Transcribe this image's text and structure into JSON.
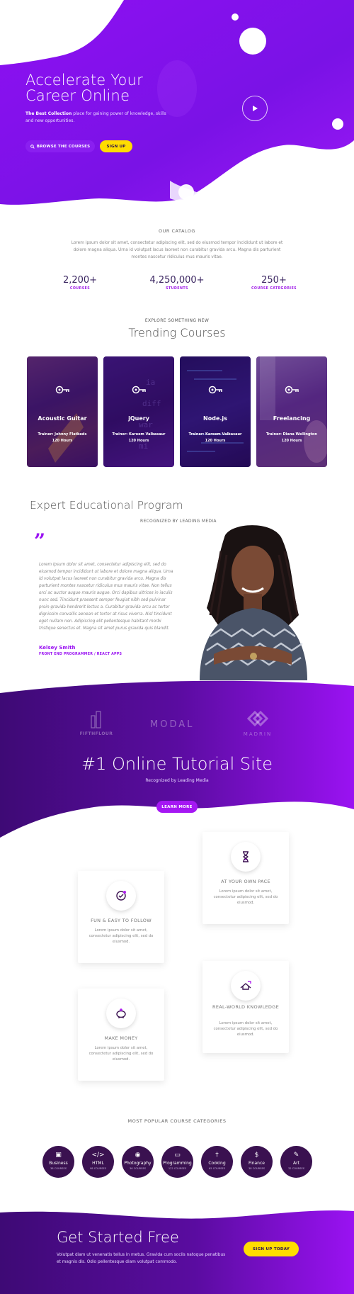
{
  "colors": {
    "brand_purple": "#8e10f2",
    "deep_purple": "#4a0f8a",
    "accent_yellow": "#ffdd00",
    "category_circle": "#3a1150"
  },
  "hero": {
    "title_line1": "Accelerate Your",
    "title_line2": "Career Online",
    "subtitle_bold": "The Best Collection",
    "subtitle_rest": " place for gaining power of knowledge, skills and new opportunities.",
    "browse_label": "BROWSE THE COURSES",
    "signup_label": "SIGN UP",
    "play_icon": "play-icon"
  },
  "catalog": {
    "label": "OUR CATALOG",
    "text": "Lorem ipsum dolor sit amet, consectetur adipiscing elit, sed do eiusmod tempor incididunt ut labore et dolore magna aliqua. Urna id volutpat lacus laoreet non curabitur gravida arcu. Magna dis parturient montes nascetur ridiculus mus mauris vitae.",
    "stats": [
      {
        "value": "2,200+",
        "label": "COURSES"
      },
      {
        "value": "4,250,000+",
        "label": "STUDENTS"
      },
      {
        "value": "250+",
        "label": "COURSE CATEGORIES"
      }
    ]
  },
  "trending": {
    "label": "EXPLORE SOMETHING NEW",
    "title": "Trending Courses",
    "courses": [
      {
        "name": "Acoustic Guitar",
        "trainer": "Trainer: Johnny Flatbeds",
        "hours": "120 Hours"
      },
      {
        "name": "jQuery",
        "trainer": "Trainer: Kareem Valbasaur",
        "hours": "120 Hours"
      },
      {
        "name": "Node.js",
        "trainer": "Trainer: Kareem Valbasaur",
        "hours": "120 Hours"
      },
      {
        "name": "Freelancing",
        "trainer": "Trainer: Diana Wellington",
        "hours": "120 Hours"
      }
    ]
  },
  "expert": {
    "title": "Expert Educational Program",
    "recognized": "RECOGNIZED BY LEADING MEDIA",
    "quote_mark": "”",
    "text": "Lorem ipsum dolor sit amet, consectetur adipiscing elit, sed do eiusmod tempor incididunt ut labore et dolore magna aliqua. Urna id volutpat lacus laoreet non curabitur gravida arcu. Magna dis parturient montes nascetur ridiculus mus mauris vitae. Non tellus orci ac auctor augue mauris augue. Orci dapibus ultrices in iaculis nunc sed. Tincidunt praesent semper feugiat nibh sed pulvinar proin gravida hendrerit lectus a. Curabitur gravida arcu ac tortor dignissim convallis aenean et tortor at risus viverra. Nisl tincidunt eget nullam non. Adipiscing elit pellentesque habitant morbi tristique senectus et. Magna sit amet purus gravida quis blandit.",
    "name": "Kelsey Smith",
    "role": "FRONT END PROGRAMMER / REACT APPS"
  },
  "band": {
    "logos": [
      "FIFTHFLOUR",
      "MODAL",
      "MADRIN"
    ],
    "title": "#1 Online Tutorial Site",
    "subtitle": "Recognized by Leading Media",
    "learn_more": "LEARN MORE"
  },
  "features": [
    {
      "title": "AT YOUR OWN PACE",
      "text": "Lorem ipsum dolor sit amet, consectetur adipiscing elit, sed do eiusmod.",
      "icon": "hourglass-icon"
    },
    {
      "title": "FUN & EASY TO FOLLOW",
      "text": "Lorem ipsum dolor sit amet, consectetur adipiscing elit, sed do eiusmod.",
      "icon": "easy-follow-icon"
    },
    {
      "title": "REAL-WORLD KNOWLEDGE",
      "text": "Lorem ipsum dolor sit amet, consectetur adipiscing elit, sed do eiusmod.",
      "icon": "knowledge-icon"
    },
    {
      "title": "MAKE MONEY",
      "text": "Lorem ipsum dolor sit amet, consectetur adipiscing elit, sed do eiusmod.",
      "icon": "piggy-bank-icon"
    }
  ],
  "categories": {
    "label": "MOST POPULAR COURSE CATEGORIES",
    "items": [
      {
        "name": "Business",
        "count": "38 COURSES",
        "icon": "briefcase-icon",
        "glyph": "▣"
      },
      {
        "name": "HTML",
        "count": "98 COURSES",
        "icon": "code-icon",
        "glyph": "</>"
      },
      {
        "name": "Photography",
        "count": "36 COURSES",
        "icon": "camera-icon",
        "glyph": "◉"
      },
      {
        "name": "Programming",
        "count": "122 COURSES",
        "icon": "laptop-icon",
        "glyph": "▭"
      },
      {
        "name": "Cooking",
        "count": "65 COURSES",
        "icon": "cutlery-icon",
        "glyph": "†"
      },
      {
        "name": "Finance",
        "count": "38 COURSES",
        "icon": "dollar-icon",
        "glyph": "$"
      },
      {
        "name": "Art",
        "count": "32 COURSES",
        "icon": "brush-icon",
        "glyph": "✎"
      }
    ]
  },
  "cta": {
    "title": "Get Started Free",
    "text": "Volutpat diam ut venenatis tellus in metus. Gravida cum sociis natoque penatibus et magnis dis. Odio pellentesque diam volutpat commodo.",
    "button": "SIGN UP TODAY"
  }
}
